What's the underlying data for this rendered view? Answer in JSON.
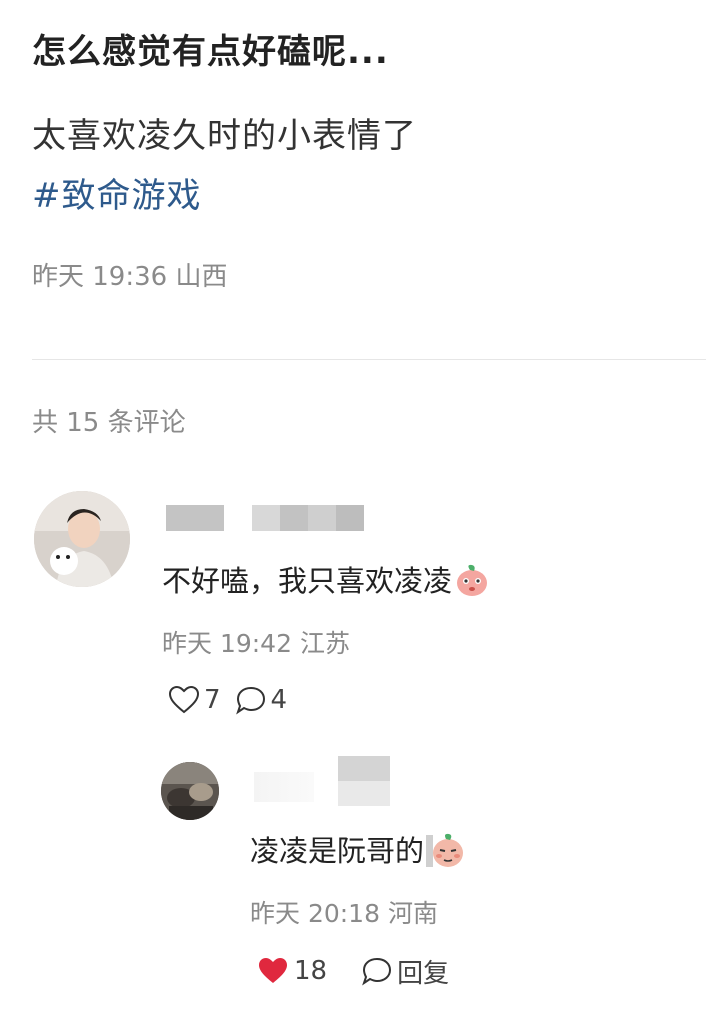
{
  "post": {
    "title": "怎么感觉有点好磕呢...",
    "body": "太喜欢凌久时的小表情了",
    "tag": "#致命游戏",
    "date": "昨天 19:36",
    "location": "山西"
  },
  "comments_header": "共 15 条评论",
  "comments": [
    {
      "text": "不好嗑，我只喜欢凌凌",
      "emoji": "peach-emoji",
      "date": "昨天 19:42",
      "location": "江苏",
      "likes": "7",
      "replies": "4",
      "liked": false
    },
    {
      "text": "凌凌是阮哥的",
      "emoji": "peach-face-emoji",
      "date": "昨天 20:18",
      "location": "河南",
      "likes": "18",
      "reply_label": "回复",
      "liked": true
    }
  ],
  "colors": {
    "tag": "#2e5a8c",
    "meta": "#8a8a8a",
    "like_active": "#e0283e"
  }
}
